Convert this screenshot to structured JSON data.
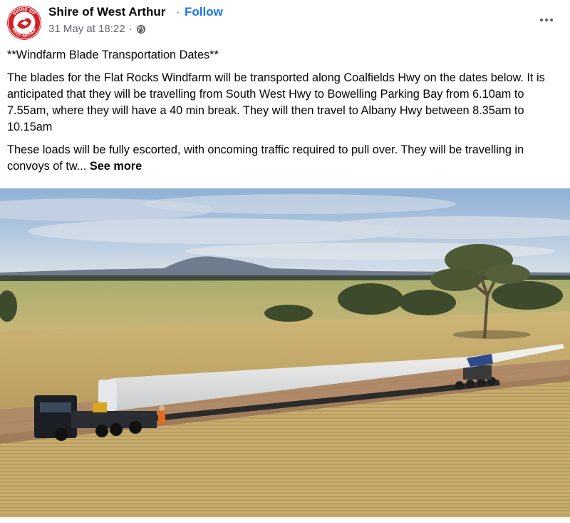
{
  "post": {
    "page_name": "Shire of West Arthur",
    "separator": "·",
    "follow_label": "Follow",
    "timestamp": "31 May at 18:22",
    "meta_separator": "·",
    "privacy_icon": "globe-icon",
    "more_icon": "more-horizontal-icon",
    "avatar": {
      "top_text": "SHIRE OF",
      "bottom_text": "WEST ARTHUR",
      "colors": {
        "ring": "#d32027",
        "inner": "#ffffff"
      }
    },
    "title": "**Windfarm Blade Transportation Dates**",
    "paragraph_1": "The blades for the Flat Rocks Windfarm will be transported along Coalfields Hwy on the dates below.  It is anticipated that they will be travelling from South West Hwy to Bowelling Parking Bay from 6.10am to 7.55am, where they will have a 40 min break.  They will then travel to Albany Hwy between 8.35am to 10.15am",
    "paragraph_2": "These loads will be fully escorted, with oncoming traffic required to pull over.  They will be travelling in convoys of tw...",
    "see_more_label": "See more",
    "image_alt": "Truck transporting a wind turbine blade along a rural road between paddocks"
  },
  "colors": {
    "link": "#1877f2",
    "secondary_text": "#65676b",
    "primary_text": "#050505"
  }
}
